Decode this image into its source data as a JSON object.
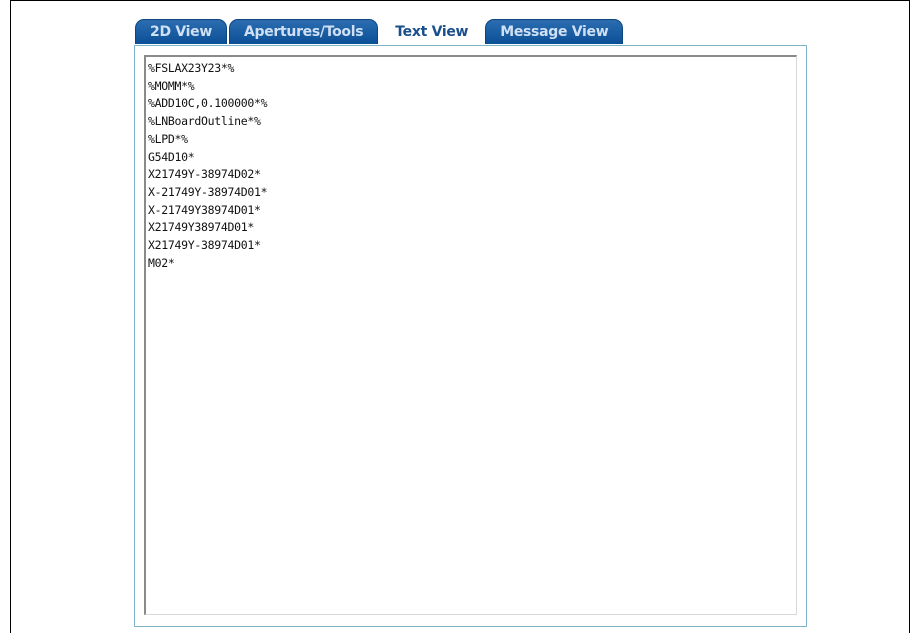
{
  "tabs": [
    {
      "label": "2D View",
      "active": false
    },
    {
      "label": "Apertures/Tools",
      "active": false
    },
    {
      "label": "Text View",
      "active": true
    },
    {
      "label": "Message View",
      "active": false
    }
  ],
  "text_view": {
    "lines": [
      "%FSLAX23Y23*%",
      "%MOMM*%",
      "%ADD10C,0.100000*%",
      "%LNBoardOutline*%",
      "%LPD*%",
      "G54D10*",
      "X21749Y-38974D02*",
      "X-21749Y-38974D01*",
      "X-21749Y38974D01*",
      "X21749Y38974D01*",
      "X21749Y-38974D01*",
      "M02*"
    ]
  },
  "colors": {
    "tab_bg": "#0b4f96",
    "tab_text": "#cfe0f5",
    "active_tab_text": "#1a4f8c",
    "panel_border": "#7fb3c9"
  }
}
